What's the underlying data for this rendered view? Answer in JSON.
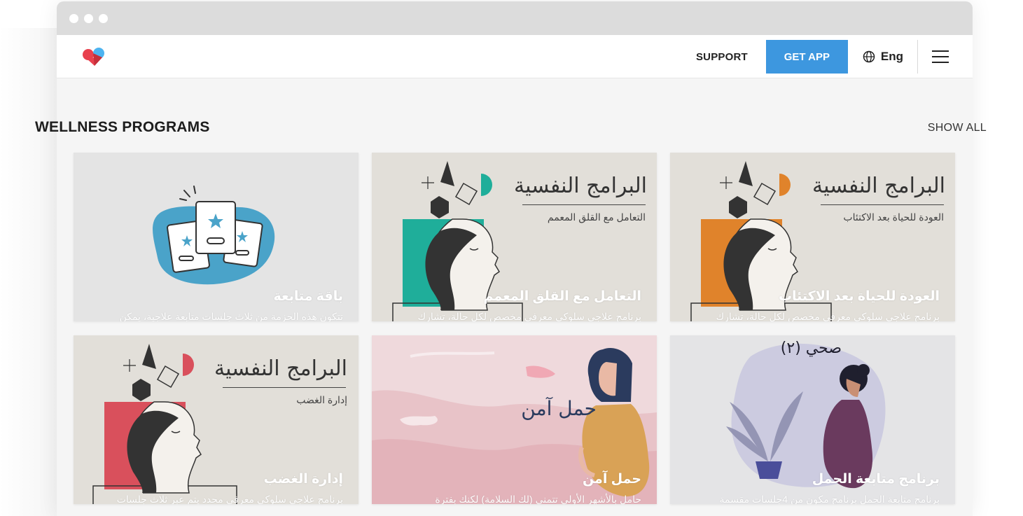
{
  "navbar": {
    "support_label": "SUPPORT",
    "get_app_label": "GET APP",
    "language_label": "Eng",
    "accent_color": "#3d97df"
  },
  "section": {
    "title": "WELLNESS PROGRAMS",
    "show_all_label": "SHOW ALL"
  },
  "cards": [
    {
      "title": "العودة للحياة بعد الاكتئاب",
      "description": "برنامج علاجي سلوكي معرفي مخصص لكل حالة، تشارك",
      "art_heading": "البرامج النفسية",
      "art_sub": "العودة للحياة بعد الاكتئاب",
      "accent": "#e0832b"
    },
    {
      "title": "التعامل مع القلق المعمم",
      "description": "برنامج علاجي سلوكي معرفي مخصص لكل حالة، تشارك",
      "art_heading": "البرامج النفسية",
      "art_sub": "التعامل مع القلق المعمم",
      "accent": "#1fae9a"
    },
    {
      "title": "باقة متابعة",
      "description": "تتكون هذه الحزمة من ثلاث جلسات متابعة علاجية، يمكن",
      "accent": "#4aa3c9"
    },
    {
      "title": "برنامج متابعة الحمل",
      "description": "برنامج متابعة الحمل برنامج مكون من 4جلسات مقسمة",
      "art_heading": "صحي (٢)",
      "accent": "#6a3a5e"
    },
    {
      "title": "حمل آمن",
      "description": "حامل بالأشهر الأولى تتمنى (لك السلامة) لكنك بفترة",
      "art_heading": "حمل آمن",
      "accent": "#e8aeb6"
    },
    {
      "title": "إدارة الغضب",
      "description": "برنامج علاجي سلوكي معرفي محدد يتم عبر ثلاث جلسات",
      "art_heading": "البرامج النفسية",
      "art_sub": "إدارة الغضب",
      "accent": "#d9505c"
    }
  ]
}
